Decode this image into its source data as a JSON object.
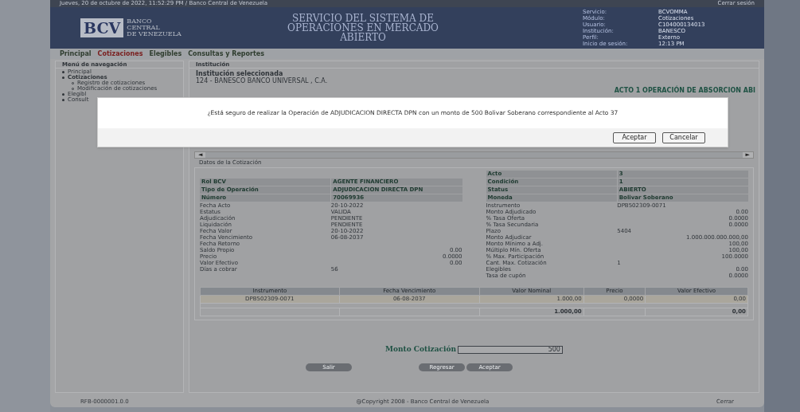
{
  "top_bar": {
    "date": "Jueves, 20 de octubre de 2022, 11:52:29 PM / Banco Central de Venezuela",
    "logout": "Cerrar sesión"
  },
  "logo": {
    "mark": "BCV",
    "name_lines": [
      "BANCO",
      "CENTRAL",
      "DE VENEZUELA"
    ]
  },
  "title_lines": [
    "SERVICIO DEL SISTEMA DE",
    "OPERACIONES EN MERCADO",
    "ABIERTO"
  ],
  "session": [
    {
      "label": "Servicio:",
      "value": "BCVOMMA"
    },
    {
      "label": "Módulo:",
      "value": "Cotizaciones"
    },
    {
      "label": "Usuario:",
      "value": "C104000134013"
    },
    {
      "label": "Institución:",
      "value": "BANESCO"
    },
    {
      "label": "Perfil:",
      "value": "Externo"
    },
    {
      "label": "Inicio de sesión:",
      "value": "12:13 PM"
    }
  ],
  "nav": [
    {
      "label": "Principal",
      "selected": false
    },
    {
      "label": "Cotizaciones",
      "selected": true
    },
    {
      "label": "Elegibles",
      "selected": false
    },
    {
      "label": "Consultas y Reportes",
      "selected": false
    }
  ],
  "sidebar": {
    "title": "Menú de navegación",
    "items": [
      {
        "label": "Principal"
      },
      {
        "label": "Cotizaciones",
        "children": [
          {
            "label": "Registro de cotizaciones"
          },
          {
            "label": "Modificación de cotizaciones"
          }
        ]
      },
      {
        "label": "Elegibl"
      },
      {
        "label": "Consult"
      }
    ]
  },
  "institution": {
    "section": "Institución",
    "label": "Institución seleccionada",
    "value": "124 - BANESCO BANCO UNIVERSAL , C.A."
  },
  "acto_title": "ACTO 1 OPERACIÓN DE ABSORCION ABI",
  "scroll": {
    "left": "◄",
    "right": "►"
  },
  "details_title": "Datos de la Cotización",
  "details_left": [
    {
      "kind": "header",
      "label": "Rol BCV",
      "value": "AGENTE FINANCIERO"
    },
    {
      "kind": "header",
      "label": "Tipo de Operación",
      "value": "ADJUDICACION DIRECTA DPN"
    },
    {
      "kind": "header",
      "label": "Número",
      "value": "70069936"
    },
    {
      "kind": "text",
      "label": "Fecha Acto",
      "value": "20-10-2022"
    },
    {
      "kind": "text",
      "label": "Estatus",
      "value": "VALIDA"
    },
    {
      "kind": "text",
      "label": "Adjudicación",
      "value": "PENDIENTE"
    },
    {
      "kind": "text",
      "label": "Liquidación",
      "value": "PENDIENTE"
    },
    {
      "kind": "text",
      "label": "Fecha Valor",
      "value": "20-10-2022"
    },
    {
      "kind": "text",
      "label": "Fecha Vencimiento",
      "value": "06-08-2037"
    },
    {
      "kind": "text",
      "label": "Fecha Retorno"
    },
    {
      "kind": "number",
      "label": "Saldo Propio",
      "value": "0.00"
    },
    {
      "kind": "number",
      "label": "Precio",
      "value": "0.0000"
    },
    {
      "kind": "number",
      "label": "Valor Efectivo",
      "value": "0.00"
    },
    {
      "kind": "text",
      "label": "Días a cobrar",
      "value": "56"
    }
  ],
  "details_right": [
    {
      "kind": "header",
      "label": "Acto",
      "value": "3"
    },
    {
      "kind": "header",
      "label": "Condición",
      "value": "1"
    },
    {
      "kind": "header",
      "label": "Status",
      "value": "ABIERTO"
    },
    {
      "kind": "header",
      "label": "Moneda",
      "value": "Bolivar Soberano"
    },
    {
      "kind": "text",
      "label": "Instrumento",
      "value": "DPB502309-0071"
    },
    {
      "kind": "number",
      "label": "Monto Adjudicado",
      "value": "0.00"
    },
    {
      "kind": "number",
      "label": "% Tasa Oferta",
      "value": "0.0000"
    },
    {
      "kind": "number",
      "label": "% Tasa Secundaria",
      "value": "0.0000"
    },
    {
      "kind": "text",
      "label": "Plazo",
      "value": "5404"
    },
    {
      "kind": "number",
      "label": "Monto Adjudicar",
      "value": "1.000.000.000.000,00"
    },
    {
      "kind": "number",
      "label": "Monto Mínimo a Adj.",
      "value": "100,00"
    },
    {
      "kind": "number",
      "label": "Múltiplo Mín. Oferta",
      "value": "100,00"
    },
    {
      "kind": "number",
      "label": "% Max. Participación",
      "value": "100.0000"
    },
    {
      "kind": "text",
      "label": "Cant. Max. Cotización",
      "value": "1"
    },
    {
      "kind": "number",
      "label": "Elegibles",
      "value": "0.00"
    },
    {
      "kind": "number",
      "label": "Tasa de cupón",
      "value": "0.0000"
    }
  ],
  "table": {
    "columns": [
      "Instrumento",
      "Fecha Vencimiento",
      "Valor Nominal",
      "Precio",
      "Valor Efectivo"
    ],
    "rows": [
      [
        "DPB502309-0071",
        "06-08-2037",
        "1.000,00",
        "0,0000",
        "0,00"
      ]
    ],
    "totals": {
      "nominal": "1.000,00",
      "effective": "0,00"
    }
  },
  "amount": {
    "label": "Monto Cotización",
    "value": "500"
  },
  "buttons": {
    "left": "Salir",
    "right": [
      "Regresar",
      "Aceptar"
    ]
  },
  "footer": {
    "left": "RFB-0000001.0.0",
    "center": "@Copyright 2008 - Banco Central de Venezuela",
    "right": "Cerrar"
  },
  "dialog": {
    "message": "¿Está seguro de realizar la Operación de ADJUDICACION DIRECTA DPN con un monto de 500 Bolivar Soberano correspondiente al Acto 37",
    "buttons": [
      "Aceptar",
      "Cancelar"
    ]
  }
}
